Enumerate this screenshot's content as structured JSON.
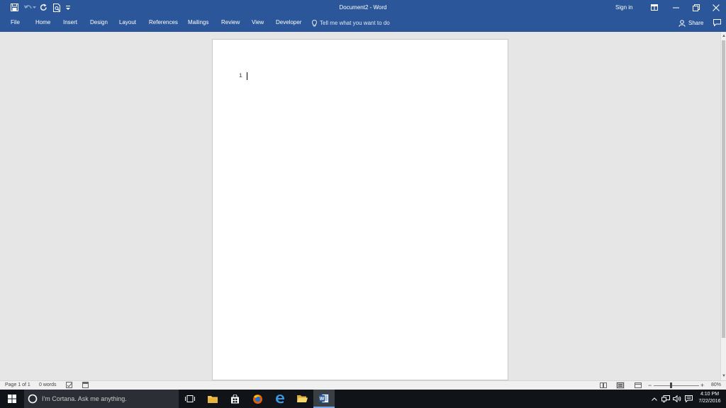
{
  "window": {
    "title": "Document2 - Word"
  },
  "qat": {
    "save_icon": "save-icon",
    "undo_icon": "undo-icon",
    "redo_icon": "redo-icon",
    "print_preview_icon": "print-preview-icon",
    "customize_icon": "customize-qat-icon"
  },
  "titlebar": {
    "signin_label": "Sign in"
  },
  "ribbon": {
    "tabs": [
      {
        "label": "File"
      },
      {
        "label": "Home"
      },
      {
        "label": "Insert"
      },
      {
        "label": "Design"
      },
      {
        "label": "Layout"
      },
      {
        "label": "References"
      },
      {
        "label": "Mailings"
      },
      {
        "label": "Review"
      },
      {
        "label": "View"
      },
      {
        "label": "Developer"
      }
    ],
    "tell_me_placeholder": "Tell me what you want to do",
    "share_label": "Share"
  },
  "document": {
    "line_number": "1"
  },
  "status": {
    "page": "Page 1 of 1",
    "words": "0 words",
    "zoom": "80%",
    "zoom_level": 0.8
  },
  "taskbar": {
    "cortana_placeholder": "I'm Cortana. Ask me anything.",
    "time": "4:10 PM",
    "date": "7/22/2016"
  },
  "colors": {
    "word_blue": "#2b579a",
    "taskbar": "#101318",
    "canvas": "#e6e6e6"
  }
}
